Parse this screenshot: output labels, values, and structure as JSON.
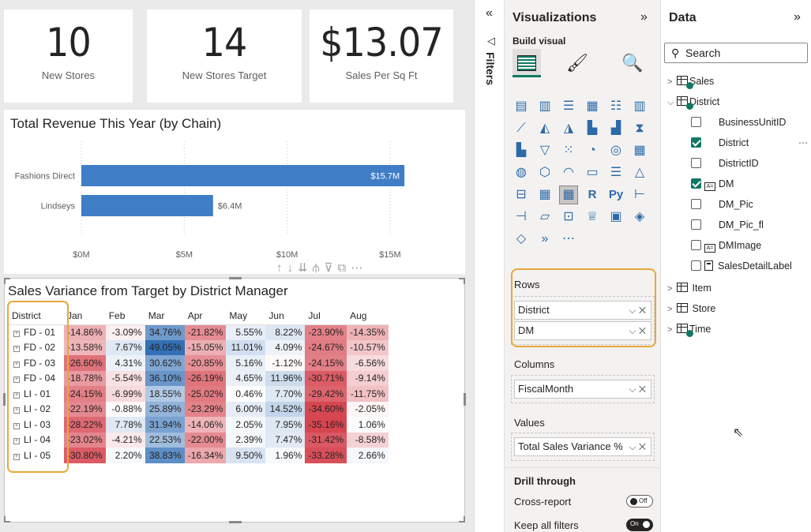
{
  "cards": [
    {
      "value": "10",
      "label": "New Stores"
    },
    {
      "value": "14",
      "label": "New Stores Target"
    },
    {
      "value": "$13.07",
      "label": "Sales Per Sq Ft"
    }
  ],
  "bar_chart": {
    "title": "Total Revenue This Year (by Chain)",
    "toolbar_icons": [
      "arrow-up-icon",
      "arrow-down-icon",
      "double-arrow-down-icon",
      "expand-hierarchy-icon",
      "filter-icon",
      "focus-mode-icon",
      "more-options-icon"
    ]
  },
  "chart_data": {
    "type": "bar",
    "orientation": "horizontal",
    "title": "Total Revenue This Year (by Chain)",
    "categories": [
      "Fashions Direct",
      "Lindseys"
    ],
    "values": [
      15.7,
      6.4
    ],
    "data_labels": [
      "$15.7M",
      "$6.4M"
    ],
    "xlim": [
      0,
      16.5
    ],
    "xticks": [
      0,
      5,
      10,
      15
    ],
    "xtick_labels": [
      "$0M",
      "$5M",
      "$10M",
      "$15M"
    ],
    "bar_color": "#3f7ec6",
    "grid": "vertical-dotted"
  },
  "matrix": {
    "title": "Sales Variance from Target by District Manager",
    "row_header": "District",
    "columns": [
      "Jan",
      "Feb",
      "Mar",
      "Apr",
      "May",
      "Jun",
      "Jul",
      "Aug"
    ],
    "rows": [
      {
        "label": "FD - 01",
        "values": [
          "-14.86%",
          "-3.09%",
          "34.76%",
          "-21.82%",
          "5.55%",
          "8.22%",
          "-23.90%",
          "-14.35%"
        ]
      },
      {
        "label": "FD - 02",
        "values": [
          "-13.58%",
          "7.67%",
          "49.05%",
          "-15.05%",
          "11.01%",
          "4.09%",
          "-24.67%",
          "-10.57%"
        ]
      },
      {
        "label": "FD - 03",
        "values": [
          "-26.60%",
          "4.31%",
          "30.62%",
          "-20.85%",
          "5.16%",
          "-1.12%",
          "-24.15%",
          "-6.56%"
        ]
      },
      {
        "label": "FD - 04",
        "values": [
          "-18.78%",
          "-5.54%",
          "36.10%",
          "-26.19%",
          "4.65%",
          "11.96%",
          "-30.71%",
          "-9.14%"
        ]
      },
      {
        "label": "LI - 01",
        "values": [
          "-24.15%",
          "-6.99%",
          "18.55%",
          "-25.02%",
          "0.46%",
          "7.70%",
          "-29.42%",
          "-11.75%"
        ]
      },
      {
        "label": "LI - 02",
        "values": [
          "-22.19%",
          "-0.88%",
          "25.89%",
          "-23.29%",
          "6.00%",
          "14.52%",
          "-34.60%",
          "-2.05%"
        ]
      },
      {
        "label": "LI - 03",
        "values": [
          "-28.22%",
          "7.78%",
          "31.94%",
          "-14.06%",
          "2.05%",
          "7.95%",
          "-35.16%",
          "1.06%"
        ]
      },
      {
        "label": "LI - 04",
        "values": [
          "-23.02%",
          "-4.21%",
          "22.53%",
          "-22.00%",
          "2.39%",
          "7.47%",
          "-31.42%",
          "-8.58%"
        ]
      },
      {
        "label": "LI - 05",
        "values": [
          "-30.80%",
          "2.20%",
          "38.83%",
          "-16.34%",
          "9.50%",
          "1.96%",
          "-33.28%",
          "2.66%"
        ]
      }
    ],
    "colors": {
      "negative": "#d64550",
      "positive": "#2f6db5",
      "highlight": "#e8a83a"
    }
  },
  "filters": {
    "label": "Filters",
    "collapse_icon": "double-chevron-left-icon"
  },
  "visualizations": {
    "title": "Visualizations",
    "build_label": "Build visual",
    "wells": [
      {
        "label": "Rows",
        "items": [
          "District",
          "DM"
        ]
      },
      {
        "label": "Columns",
        "items": [
          "FiscalMonth"
        ]
      },
      {
        "label": "Values",
        "items": [
          "Total Sales Variance %"
        ]
      }
    ],
    "drill_through": "Drill through",
    "cross_report": {
      "label": "Cross-report",
      "state": "Off"
    },
    "keep_filters": {
      "label": "Keep all filters",
      "state": "On"
    }
  },
  "data_pane": {
    "title": "Data",
    "search_placeholder": "Search",
    "tables": [
      {
        "name": "Sales",
        "expanded": false
      },
      {
        "name": "District",
        "expanded": true,
        "fields": [
          {
            "name": "BusinessUnitID",
            "checked": false
          },
          {
            "name": "District",
            "checked": true
          },
          {
            "name": "DistrictID",
            "checked": false
          },
          {
            "name": "DM",
            "checked": true,
            "icon": "text-field-icon"
          },
          {
            "name": "DM_Pic",
            "checked": false
          },
          {
            "name": "DM_Pic_fl",
            "checked": false
          },
          {
            "name": "DMImage",
            "checked": false,
            "icon": "text-field-icon"
          },
          {
            "name": "SalesDetailLabel",
            "checked": false,
            "icon": "calculator-icon"
          }
        ]
      },
      {
        "name": "Item",
        "expanded": false
      },
      {
        "name": "Store",
        "expanded": false
      },
      {
        "name": "Time",
        "expanded": false
      }
    ],
    "more_label": "⋯"
  }
}
